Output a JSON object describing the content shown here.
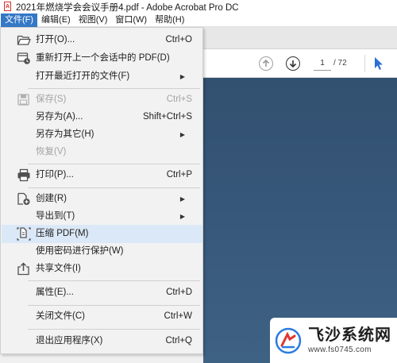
{
  "window": {
    "title": "2021年燃烧学会会议手册4.pdf - Adobe Acrobat Pro DC"
  },
  "menubar": [
    {
      "label": "文件(F)",
      "active": true
    },
    {
      "label": "编辑(E)",
      "active": false
    },
    {
      "label": "视图(V)",
      "active": false
    },
    {
      "label": "窗口(W)",
      "active": false
    },
    {
      "label": "帮助(H)",
      "active": false
    }
  ],
  "toolbar": {
    "current_page": "1",
    "total_pages": "/ 72"
  },
  "file_menu": {
    "items": [
      {
        "label": "打开(O)...",
        "shortcut": "Ctrl+O",
        "icon": "folder-open-icon"
      },
      {
        "label": "重新打开上一个会话中的 PDF(D)",
        "shortcut": "",
        "icon": "reopen-session-icon"
      },
      {
        "label": "打开最近打开的文件(F)",
        "shortcut": "",
        "submenu": true
      },
      {
        "label": "保存(S)",
        "shortcut": "Ctrl+S",
        "icon": "save-icon",
        "disabled": true
      },
      {
        "label": "另存为(A)...",
        "shortcut": "Shift+Ctrl+S"
      },
      {
        "label": "另存为其它(H)",
        "shortcut": "",
        "submenu": true
      },
      {
        "label": "恢复(V)",
        "shortcut": "",
        "disabled": true
      },
      {
        "label": "打印(P)...",
        "shortcut": "Ctrl+P",
        "icon": "printer-icon"
      },
      {
        "label": "创建(R)",
        "shortcut": "",
        "submenu": true,
        "icon": "create-pdf-icon"
      },
      {
        "label": "导出到(T)",
        "shortcut": "",
        "submenu": true
      },
      {
        "label": "压缩 PDF(M)",
        "shortcut": "",
        "icon": "compress-pdf-icon",
        "highlighted": true
      },
      {
        "label": "使用密码进行保护(W)",
        "shortcut": ""
      },
      {
        "label": "共享文件(I)",
        "shortcut": "",
        "icon": "share-icon"
      },
      {
        "label": "属性(E)...",
        "shortcut": "Ctrl+D"
      },
      {
        "label": "关闭文件(C)",
        "shortcut": "Ctrl+W"
      },
      {
        "label": "退出应用程序(X)",
        "shortcut": "Ctrl+Q"
      }
    ]
  },
  "watermark": {
    "name": "飞沙系统网",
    "url": "www.fs0745.com"
  },
  "colors": {
    "menubar_active": "#3478c6",
    "menu_hover": "#dbe8f7",
    "page_bg": "#37577a",
    "cursor": "#2a6fd6"
  }
}
